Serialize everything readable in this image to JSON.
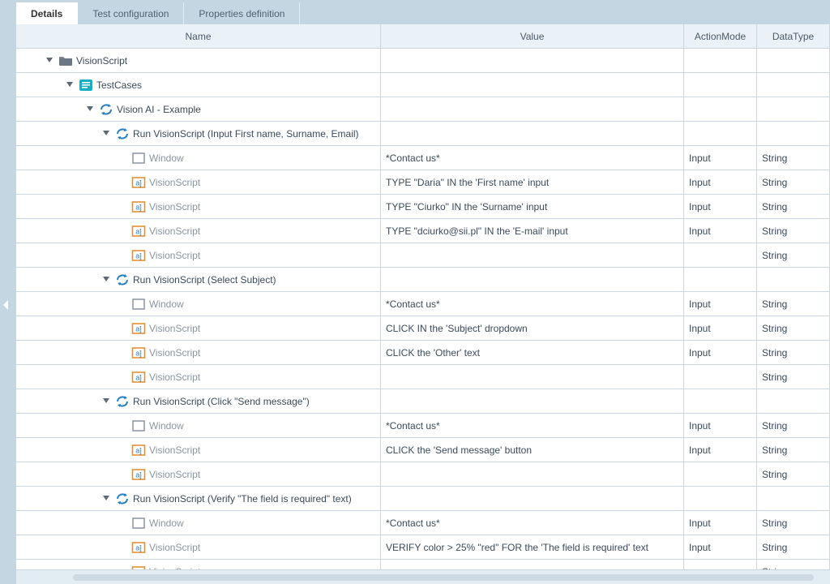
{
  "tabs": [
    {
      "label": "Details",
      "active": true
    },
    {
      "label": "Test configuration",
      "active": false
    },
    {
      "label": "Properties definition",
      "active": false
    }
  ],
  "columns": {
    "name": "Name",
    "value": "Value",
    "action": "ActionMode",
    "datatype": "DataType"
  },
  "iconColors": {
    "folder": "#6b7785",
    "testCases": "#1aaec1",
    "refresh": "#2a7fc1",
    "windowBorder": "#8a94a0",
    "abBorder": "#e18a2d",
    "abText": "#2a7fc1"
  },
  "rows": [
    {
      "indent": 30,
      "toggle": true,
      "icon": "folder",
      "name": "VisionScript",
      "muted": false,
      "value": "",
      "action": "",
      "datatype": ""
    },
    {
      "indent": 55,
      "toggle": true,
      "icon": "testcases",
      "name": "TestCases",
      "muted": false,
      "value": "",
      "action": "",
      "datatype": ""
    },
    {
      "indent": 80,
      "toggle": true,
      "icon": "refresh",
      "name": "Vision AI - Example",
      "muted": false,
      "value": "",
      "action": "",
      "datatype": ""
    },
    {
      "indent": 100,
      "toggle": true,
      "icon": "refresh",
      "name": "Run VisionScript (Input First name, Surname, Email)",
      "muted": false,
      "value": "",
      "action": "",
      "datatype": ""
    },
    {
      "indent": 120,
      "toggle": false,
      "icon": "window",
      "name": "Window",
      "muted": true,
      "value": "*Contact us*",
      "action": "Input",
      "datatype": "String"
    },
    {
      "indent": 120,
      "toggle": false,
      "icon": "ab",
      "name": "VisionScript",
      "muted": true,
      "value": "TYPE \"Daria\" IN the 'First name' input",
      "action": "Input",
      "datatype": "String"
    },
    {
      "indent": 120,
      "toggle": false,
      "icon": "ab",
      "name": "VisionScript",
      "muted": true,
      "value": "TYPE \"Ciurko\" IN the 'Surname' input",
      "action": "Input",
      "datatype": "String"
    },
    {
      "indent": 120,
      "toggle": false,
      "icon": "ab",
      "name": "VisionScript",
      "muted": true,
      "value": "TYPE \"dciurko@sii.pl\" IN the 'E-mail' input",
      "action": "Input",
      "datatype": "String"
    },
    {
      "indent": 120,
      "toggle": false,
      "icon": "ab",
      "name": "VisionScript",
      "muted": true,
      "value": "",
      "action": "",
      "datatype": "String"
    },
    {
      "indent": 100,
      "toggle": true,
      "icon": "refresh",
      "name": "Run VisionScript (Select Subject)",
      "muted": false,
      "value": "",
      "action": "",
      "datatype": ""
    },
    {
      "indent": 120,
      "toggle": false,
      "icon": "window",
      "name": "Window",
      "muted": true,
      "value": "*Contact us*",
      "action": "Input",
      "datatype": "String"
    },
    {
      "indent": 120,
      "toggle": false,
      "icon": "ab",
      "name": "VisionScript",
      "muted": true,
      "value": "CLICK IN the 'Subject' dropdown",
      "action": "Input",
      "datatype": "String"
    },
    {
      "indent": 120,
      "toggle": false,
      "icon": "ab",
      "name": "VisionScript",
      "muted": true,
      "value": "CLICK the 'Other' text",
      "action": "Input",
      "datatype": "String"
    },
    {
      "indent": 120,
      "toggle": false,
      "icon": "ab",
      "name": "VisionScript",
      "muted": true,
      "value": "",
      "action": "",
      "datatype": "String"
    },
    {
      "indent": 100,
      "toggle": true,
      "icon": "refresh",
      "name": "Run VisionScript (Click \"Send message\")",
      "muted": false,
      "value": "",
      "action": "",
      "datatype": ""
    },
    {
      "indent": 120,
      "toggle": false,
      "icon": "window",
      "name": "Window",
      "muted": true,
      "value": "*Contact us*",
      "action": "Input",
      "datatype": "String"
    },
    {
      "indent": 120,
      "toggle": false,
      "icon": "ab",
      "name": "VisionScript",
      "muted": true,
      "value": "CLICK the 'Send message' button",
      "action": "Input",
      "datatype": "String"
    },
    {
      "indent": 120,
      "toggle": false,
      "icon": "ab",
      "name": "VisionScript",
      "muted": true,
      "value": "",
      "action": "",
      "datatype": "String"
    },
    {
      "indent": 100,
      "toggle": true,
      "icon": "refresh",
      "name": "Run VisionScript (Verify \"The field is required\" text)",
      "muted": false,
      "value": "",
      "action": "",
      "datatype": ""
    },
    {
      "indent": 120,
      "toggle": false,
      "icon": "window",
      "name": "Window",
      "muted": true,
      "value": "*Contact us*",
      "action": "Input",
      "datatype": "String"
    },
    {
      "indent": 120,
      "toggle": false,
      "icon": "ab",
      "name": "VisionScript",
      "muted": true,
      "value": "VERIFY color > 25% \"red\" FOR the 'The field is required' text",
      "action": "Input",
      "datatype": "String"
    },
    {
      "indent": 120,
      "toggle": false,
      "icon": "ab",
      "name": "VisionScript",
      "muted": true,
      "value": "",
      "action": "",
      "datatype": "String"
    }
  ]
}
